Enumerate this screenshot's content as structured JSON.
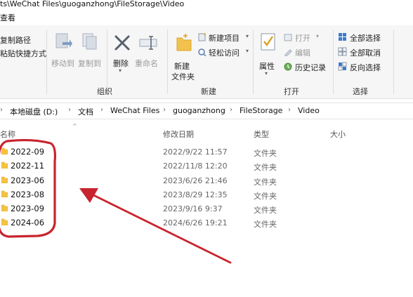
{
  "window": {
    "title_partial": "ts\\WeChat Files\\guoganzhong\\FileStorage\\Video",
    "menu_partial": "查看"
  },
  "ribbon": {
    "clipboard_items": [
      "复制路径",
      "粘贴快捷方式"
    ],
    "organize": {
      "move_to": "移动到",
      "copy_to": "复制到",
      "delete": "删除",
      "rename": "重命名",
      "label": "组织"
    },
    "new": {
      "new_folder_line1": "新建",
      "new_folder_line2": "文件夹",
      "new_item": "新建项目",
      "easy_access": "轻松访问",
      "label": "新建"
    },
    "open": {
      "properties": "属性",
      "open": "打开",
      "edit": "编辑",
      "history": "历史记录",
      "label": "打开"
    },
    "select": {
      "select_all": "全部选择",
      "select_none": "全部取消",
      "invert": "反向选择",
      "label": "选择"
    }
  },
  "address": {
    "crumbs": [
      "本地磁盘 (D:)",
      "文档",
      "WeChat Files",
      "guoganzhong",
      "FileStorage",
      "Video"
    ]
  },
  "columns": {
    "name": "名称",
    "modified": "修改日期",
    "type": "类型",
    "size": "大小"
  },
  "files": [
    {
      "name": "2022-09",
      "modified": "2022/9/22 11:57",
      "type": "文件夹"
    },
    {
      "name": "2022-11",
      "modified": "2022/11/8 12:20",
      "type": "文件夹"
    },
    {
      "name": "2023-06",
      "modified": "2023/6/26 21:46",
      "type": "文件夹"
    },
    {
      "name": "2023-08",
      "modified": "2023/8/29 12:35",
      "type": "文件夹"
    },
    {
      "name": "2023-09",
      "modified": "2023/9/16 9:37",
      "type": "文件夹"
    },
    {
      "name": "2024-06",
      "modified": "2024/6/26 19:21",
      "type": "文件夹"
    }
  ],
  "colors": {
    "annotation_red": "#c8242e",
    "folder_yellow": "#f5c342",
    "ribbon_bg": "#f6f6f6"
  }
}
